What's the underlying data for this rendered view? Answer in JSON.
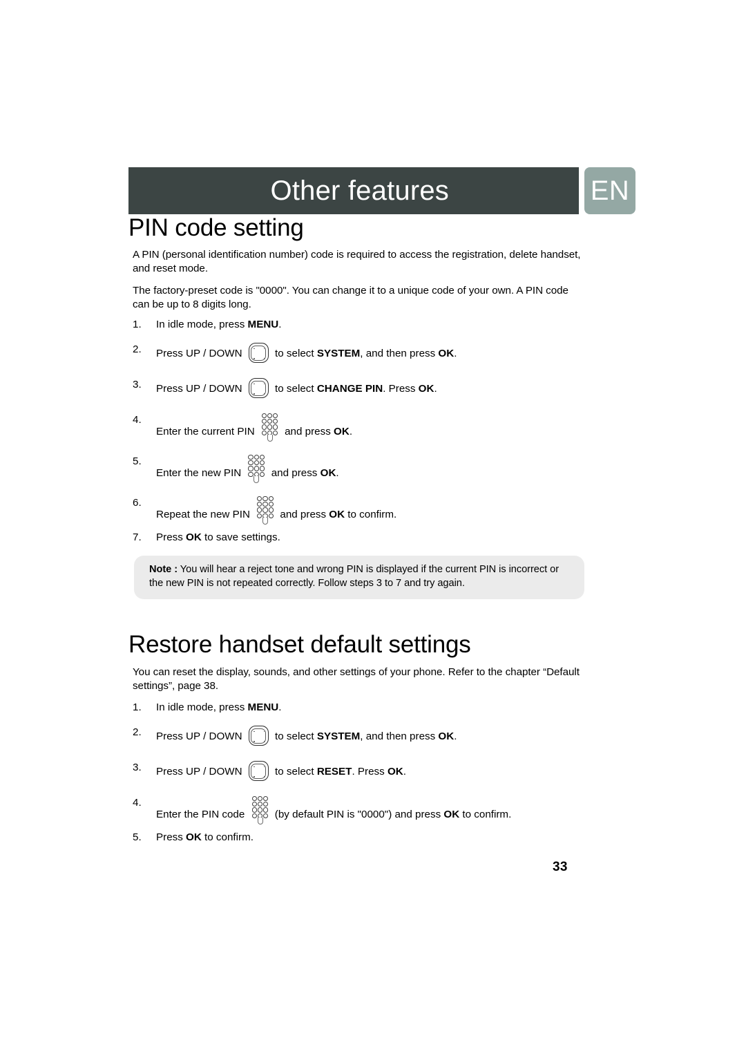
{
  "header": {
    "chapter_title": "Other features",
    "language_badge": "EN",
    "bar_color": "#3c4544",
    "badge_color": "#94a8a4"
  },
  "sections": [
    {
      "title": "PIN code setting",
      "paragraphs": [
        "A PIN (personal identification number) code is required to access the registration, delete handset, and reset mode.",
        "The factory-preset code is \"0000\". You can change it to a unique code of your own. A PIN code can be up to 8 digits long."
      ],
      "steps": [
        {
          "num": "1.",
          "icon": "none",
          "before": "In idle mode, press ",
          "bold1": "MENU",
          "mid": ".",
          "bold2": "",
          "after": ""
        },
        {
          "num": "2.",
          "icon": "nav-key-icon",
          "before": "Press  UP / DOWN ",
          "mid": " to select ",
          "bold1": "SYSTEM",
          "after": ", and then press ",
          "bold2": "OK",
          "tail": "."
        },
        {
          "num": "3.",
          "icon": "nav-key-icon",
          "before": "Press  UP / DOWN ",
          "mid": " to select ",
          "bold1": "CHANGE PIN",
          "after": ". Press ",
          "bold2": "OK",
          "tail": "."
        },
        {
          "num": "4.",
          "icon": "keypad-icon",
          "before": "Enter the current PIN ",
          "mid": " and press ",
          "bold1": "",
          "after": "",
          "bold2": "OK",
          "tail": "."
        },
        {
          "num": "5.",
          "icon": "keypad-icon",
          "before": "Enter the new PIN ",
          "mid": " and press ",
          "bold1": "",
          "after": "",
          "bold2": "OK",
          "tail": "."
        },
        {
          "num": "6.",
          "icon": "keypad-icon",
          "before": "Repeat the new PIN ",
          "mid": " and press ",
          "bold1": "",
          "after": "",
          "bold2": "OK",
          "tail": " to confirm."
        },
        {
          "num": "7.",
          "icon": "none",
          "before": "Press ",
          "bold1": "OK",
          "mid": " to save settings.",
          "bold2": "",
          "after": ""
        }
      ],
      "note": {
        "label": "Note :",
        "text": " You will hear a reject tone and wrong PIN is displayed if the current PIN is incorrect or the new PIN is not repeated correctly. Follow steps 3 to 7 and try again."
      }
    },
    {
      "title": "Restore handset default settings",
      "paragraphs": [
        "You can reset the display, sounds, and other settings of your phone. Refer to the chapter “Default settings”, page 38."
      ],
      "steps": [
        {
          "num": "1.",
          "icon": "none",
          "before": "In idle mode, press ",
          "bold1": "MENU",
          "mid": ".",
          "bold2": "",
          "after": ""
        },
        {
          "num": "2.",
          "icon": "nav-key-icon",
          "before": "Press  UP / DOWN ",
          "mid": " to select ",
          "bold1": "SYSTEM",
          "after": ", and then press ",
          "bold2": "OK",
          "tail": "."
        },
        {
          "num": "3.",
          "icon": "nav-key-icon",
          "before": "Press  UP / DOWN ",
          "mid": " to select ",
          "bold1": "RESET",
          "after": ". Press ",
          "bold2": "OK",
          "tail": "."
        },
        {
          "num": "4.",
          "icon": "keypad-icon",
          "before": "Enter the PIN code ",
          "mid": " (by default PIN is \"0000\") and press ",
          "bold1": "",
          "after": "",
          "bold2": "OK",
          "tail": " to confirm."
        },
        {
          "num": "5.",
          "icon": "none",
          "before": "Press ",
          "bold1": "OK",
          "mid": " to confirm.",
          "bold2": "",
          "after": ""
        }
      ]
    }
  ],
  "footer": {
    "page_number": "33"
  }
}
